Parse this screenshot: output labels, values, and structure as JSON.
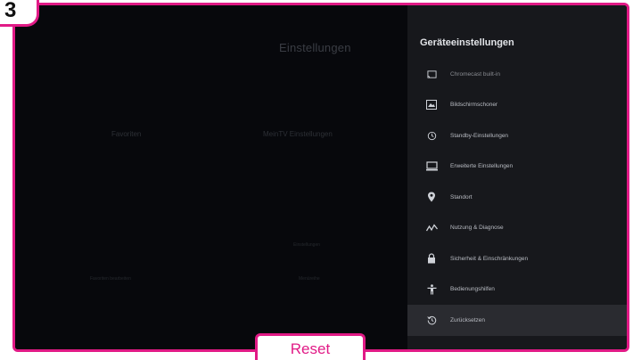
{
  "step": {
    "number": "3"
  },
  "background": {
    "title": "Einstellungen",
    "col1_label": "Favoriten",
    "col2_label": "MeinTV Einstellungen",
    "small1": "Einstellungen",
    "small2": "Favoriten bearbeiten",
    "small3": "Menüreihe"
  },
  "panel": {
    "title": "Geräteeinstellungen",
    "items": [
      {
        "icon": "cast-icon",
        "label": "Chromecast built-in"
      },
      {
        "icon": "screensaver-icon",
        "label": "Bildschirmschoner"
      },
      {
        "icon": "standby-icon",
        "label": "Standby-Einstellungen"
      },
      {
        "icon": "monitor-icon",
        "label": "Erweiterte Einstellungen"
      },
      {
        "icon": "location-pin-icon",
        "label": "Standort"
      },
      {
        "icon": "diagnostics-icon",
        "label": "Nutzung & Diagnose"
      },
      {
        "icon": "lock-icon",
        "label": "Sicherheit & Einschränkungen"
      },
      {
        "icon": "accessibility-icon",
        "label": "Bedienungshilfen"
      },
      {
        "icon": "reset-icon",
        "label": "Zurücksetzen"
      }
    ],
    "active_index": 8
  },
  "caption": {
    "label": "Reset"
  },
  "colors": {
    "accent": "#e11a86",
    "panel_bg": "#17181c",
    "screen_bg": "#07080c"
  }
}
